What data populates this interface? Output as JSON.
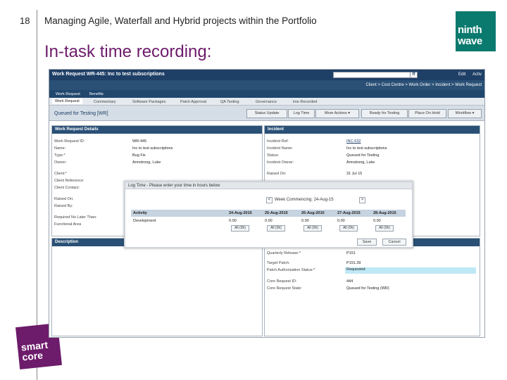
{
  "slide": {
    "number": "18",
    "header": "Managing Agile, Waterfall and Hybrid projects within the Portfolio",
    "title": "In-task time recording:",
    "brand_top_line1": "ninth",
    "brand_top_line2": "wave",
    "brand_bottom_line1": "smart",
    "brand_bottom_line2": "core",
    "colors": {
      "accent": "#6d1b6b",
      "brand_green": "#0a7a6e",
      "app_navy": "#1e3f66"
    }
  },
  "app": {
    "title": "Work Request WR-445: Inc to test subscriptions",
    "search_button": "ff",
    "edit_label": "Edit",
    "active_label": "Activ",
    "breadcrumb": "Client > Cost Centre > Work Order > Incident > Work Request",
    "top_tabs": [
      "Work Request",
      "Benefits"
    ],
    "sub_tabs": [
      "Work Request",
      "Commentary",
      "Software Packages",
      "Patch Approval",
      "QA Testing",
      "Governance",
      "ime Recorded"
    ],
    "status_text": "Queued for Testing [WR]",
    "toolbar_buttons": [
      "Status Update",
      "Log Time",
      "More Actions ▾",
      "Ready for Testing",
      "Place On Hold",
      "Workflow ▾"
    ],
    "work_request_panel": {
      "title": "Work Request Details",
      "rows": [
        {
          "label": "Work Request ID:",
          "value": "WR-445"
        },
        {
          "label": "Name:",
          "value": "Inc to test subscriptions"
        },
        {
          "label": "Type:*",
          "value": "Bug Fix"
        },
        {
          "label": "Owner:",
          "value": "Armstrong, Luke"
        },
        {
          "label": "Client:*",
          "value": ""
        },
        {
          "label": "Client Reference:",
          "value": ""
        },
        {
          "label": "Client Contact:",
          "value": ""
        },
        {
          "label": "Raised On:",
          "value": ""
        },
        {
          "label": "Raised By:",
          "value": ""
        },
        {
          "label": "Required No Later Than:",
          "value": ""
        },
        {
          "label": "Functional Area",
          "value": ""
        }
      ]
    },
    "incident_panel": {
      "title": "Incident",
      "rows": [
        {
          "label": "Incident Ref:",
          "value": "INC-532"
        },
        {
          "label": "Incident Name:",
          "value": "Inc to test subscriptions"
        },
        {
          "label": "Status:",
          "value": "Queued for Testing"
        },
        {
          "label": "Incident Owner:",
          "value": "Armstrong, Luke"
        },
        {
          "label": "Raised On:",
          "value": "31 Jul 15"
        }
      ]
    },
    "description_panel": {
      "title": "Description"
    },
    "release_rows": [
      {
        "label": "Quarterly Release:*",
        "value": "P151"
      },
      {
        "label": "Target Patch:",
        "value": "P151.39"
      },
      {
        "label": "Patch Authorisation Status:*",
        "value": "Requested"
      },
      {
        "label": "Core Request ID:",
        "value": "444"
      },
      {
        "label": "Core Request State:",
        "value": "Queued for Testing (WR)"
      }
    ],
    "log_time_modal": {
      "title": "Log Time - Please enter your time in hours below",
      "prev": "<",
      "next": ">",
      "week_label": "Week Commencing: 24-Aug-15",
      "columns": [
        "Activity",
        "24-Aug-2015",
        "25-Aug-2015",
        "26-Aug-2015",
        "27-Aug-2015",
        "28-Aug-2015"
      ],
      "row_activity": "Development",
      "row_values": [
        "0.00",
        "0.00",
        "0.00",
        "0.00",
        "0.00"
      ],
      "all_buttons": [
        "All (0h)",
        "All (0h)",
        "All (0h)",
        "All (0h)",
        "All (0h)"
      ],
      "save": "Save",
      "cancel": "Cancel"
    }
  }
}
